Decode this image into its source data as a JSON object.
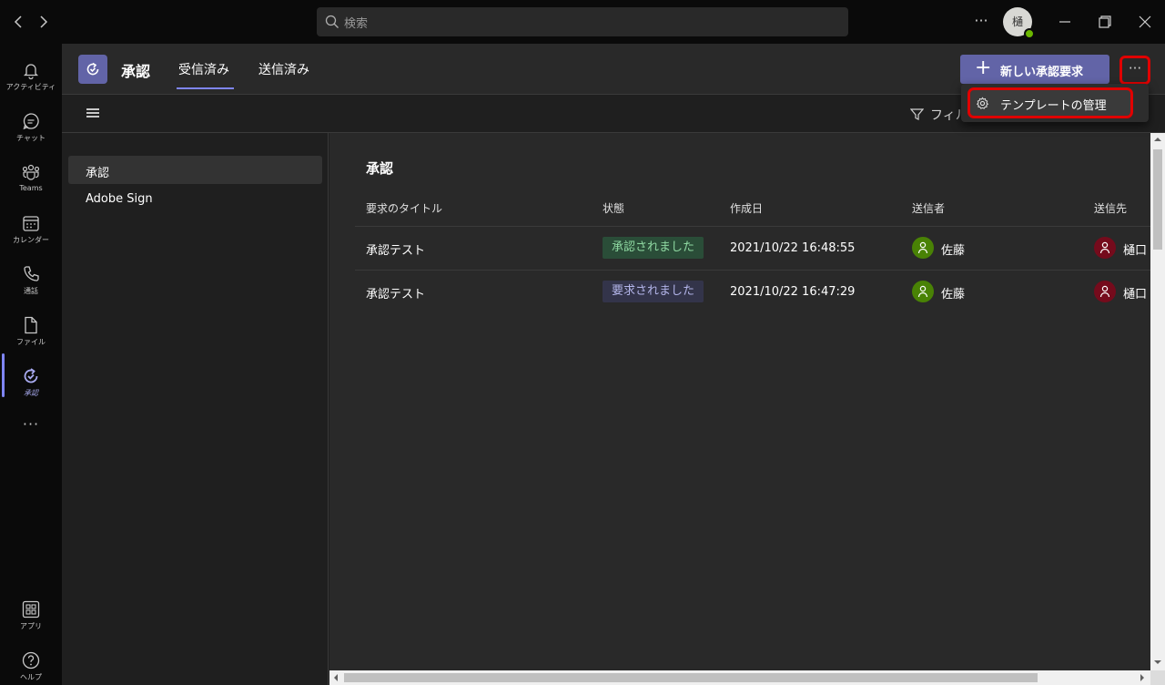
{
  "titlebar": {
    "back_glyph": "‹",
    "forward_glyph": "›",
    "search_placeholder": "検索",
    "more_glyph": "···",
    "avatar_initial": "樋"
  },
  "rail": {
    "items": [
      {
        "label": "アクティビティ",
        "icon": "bell-icon"
      },
      {
        "label": "チャット",
        "icon": "chat-icon"
      },
      {
        "label": "Teams",
        "icon": "teams-icon"
      },
      {
        "label": "カレンダー",
        "icon": "calendar-icon"
      },
      {
        "label": "通話",
        "icon": "phone-icon"
      },
      {
        "label": "ファイル",
        "icon": "file-icon"
      },
      {
        "label": "承認",
        "icon": "approvals-icon"
      },
      {
        "label": "アプリ",
        "icon": "apps-icon"
      },
      {
        "label": "ヘルプ",
        "icon": "help-icon"
      }
    ],
    "more_glyph": "···"
  },
  "header": {
    "app_title": "承認",
    "tabs": [
      {
        "label": "受信済み",
        "active": true
      },
      {
        "label": "送信済み",
        "active": false
      }
    ],
    "new_button_label": "新しい承認要求",
    "more_glyph": "···"
  },
  "toolbar": {
    "filter_label": "フィル"
  },
  "dropdown": {
    "item_label": "テンプレートの管理"
  },
  "sidepanel": {
    "items": [
      {
        "label": "承認",
        "active": true
      },
      {
        "label": "Adobe Sign",
        "active": false
      }
    ]
  },
  "main": {
    "title": "承認",
    "columns": [
      "要求のタイトル",
      "状態",
      "作成日",
      "送信者",
      "送信先"
    ],
    "rows": [
      {
        "title": "承認テスト",
        "status": "承認されました",
        "status_kind": "approved",
        "created": "2021/10/22 16:48:55",
        "sender": "佐藤",
        "recipient": "樋口"
      },
      {
        "title": "承認テスト",
        "status": "要求されました",
        "status_kind": "requested",
        "created": "2021/10/22 16:47:29",
        "sender": "佐藤",
        "recipient": "樋口"
      }
    ]
  },
  "colors": {
    "accent": "#6264a7",
    "highlight": "#e00000",
    "approved_bg": "#2a4d38",
    "requested_bg": "#33344a"
  }
}
